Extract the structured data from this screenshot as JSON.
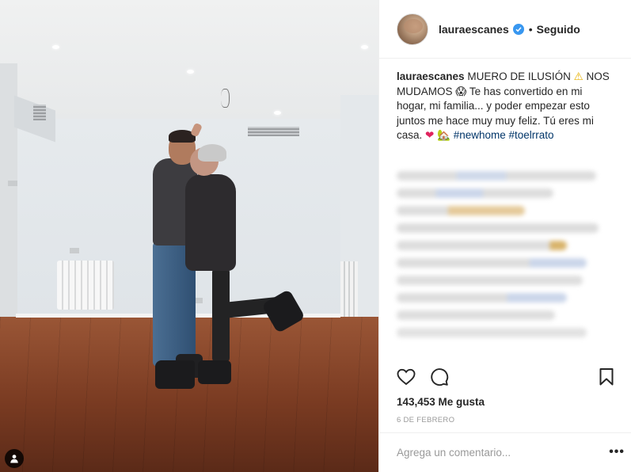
{
  "header": {
    "username": "lauraescanes",
    "separator": "•",
    "follow_status": "Seguido"
  },
  "caption": {
    "username": "lauraescanes",
    "text_1": "MUERO DE ILUSIÓN",
    "text_2": "NOS MUDAMOS",
    "text_3": "Te has convertido en mi hogar, mi familia... y poder empezar esto juntos me hace muy muy feliz. Tú eres mi casa.",
    "hashtag_1": "#newhome",
    "hashtag_2": "#toelrrato"
  },
  "icons": {
    "warning": "⚠",
    "scream": "😱",
    "heart": "❤",
    "house": "🏡"
  },
  "stats": {
    "likes": "143,453 Me gusta",
    "date": "6 DE FEBRERO"
  },
  "comment_box": {
    "placeholder": "Agrega un comentario...",
    "more": "•••"
  },
  "colors": {
    "verified": "#3897f0",
    "hashtag": "#003569",
    "heart": "#ed4956",
    "muted": "#999999"
  }
}
